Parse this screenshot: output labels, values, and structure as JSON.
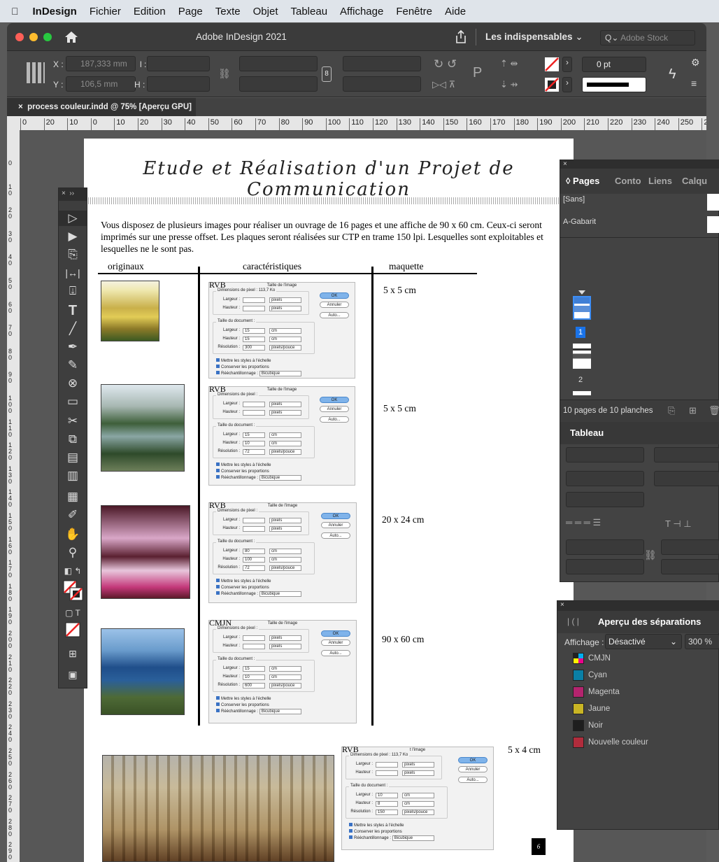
{
  "menubar": {
    "apple": "",
    "app": "InDesign",
    "items": [
      "Fichier",
      "Edition",
      "Page",
      "Texte",
      "Objet",
      "Tableau",
      "Affichage",
      "Fenêtre",
      "Aide"
    ]
  },
  "window": {
    "title": "Adobe InDesign 2021",
    "workspace": "Les indispensables",
    "stock_placeholder": "Adobe Stock"
  },
  "control": {
    "x_label": "X :",
    "x_value": "187,333 mm",
    "y_label": "Y :",
    "y_value": "106,5 mm",
    "w_label": "l :",
    "h_label": "H :",
    "stroke_pt": "0 pt"
  },
  "doc_tab": {
    "close": "×",
    "label": "process couleur.indd @ 75% [Aperçu GPU]"
  },
  "rulers": {
    "h": [
      "0",
      "20",
      "10",
      "0",
      "10",
      "20",
      "30",
      "40",
      "50",
      "60",
      "70",
      "80",
      "90",
      "100",
      "110",
      "120",
      "130",
      "140",
      "150",
      "160",
      "170",
      "180",
      "190",
      "200",
      "210",
      "220",
      "230",
      "240",
      "250",
      "2"
    ],
    "v": [
      "0",
      "10",
      "20",
      "30",
      "40",
      "50",
      "60",
      "70",
      "80",
      "90",
      "100",
      "110",
      "120",
      "130",
      "140",
      "150",
      "160",
      "170",
      "180",
      "190",
      "200",
      "210",
      "220",
      "230",
      "240",
      "250",
      "260",
      "270",
      "280",
      "290"
    ]
  },
  "page": {
    "title": "Etude et Réalisation d'un Projet de Communication",
    "intro": "Vous disposez de plusieurs images pour réaliser un ouvrage de 16 pages et une affiche de 90 x 60 cm. Ceux-ci seront imprimés sur une presse offset. Les plaques seront réalisées sur CTP en trame 150 lpi. Lesquelles sont exploitables et lesquelles ne le sont pas.",
    "col_originaux": "originaux",
    "col_caract": "caractéristiques",
    "col_maquette": "maquette",
    "dialog": {
      "title": "Taille de l'image",
      "ok": "OK",
      "annuler": "Annuler",
      "auto": "Auto...",
      "dim_pixel": "Dimensions de pixel",
      "taille_doc": "Taille du document :",
      "largeur": "Largeur :",
      "hauteur": "Hauteur :",
      "resolution": "Résolution :",
      "pixels": "pixels",
      "cm": "cm",
      "pixpouce": "pixels/pouce",
      "ck1": "Mettre les styles à l'échelle",
      "ck2": "Conserver les proportions",
      "ck3": "Rééchantillonnage :",
      "bicubique": "Bicubique"
    },
    "rows": [
      {
        "mode": "RVB",
        "pix": "Dimensions de pixel : 113,7 Ko",
        "l": "15",
        "h": "15",
        "res": "300",
        "size": "5 x 5 cm"
      },
      {
        "mode": "RVB",
        "pix": "Dimensions de pixel :",
        "l": "15",
        "h": "10",
        "res": "72",
        "size": "5 x 5 cm"
      },
      {
        "mode": "RVB",
        "pix": "Dimensions de pixel :",
        "l": "80",
        "h": "100",
        "res": "72",
        "size": "20 x 24 cm"
      },
      {
        "mode": "CMJN",
        "pix": "Dimensions de pixel :",
        "l": "15",
        "h": "10",
        "res": "600",
        "size": "90 x 60 cm"
      },
      {
        "mode": "RVB",
        "pix": "Dimensions de pixel : 113,7 Ko",
        "l": "10",
        "h": "8",
        "res": "150",
        "size": "5 x 4 cm",
        "title": "t l'image"
      }
    ],
    "page_number": "6"
  },
  "pages_panel": {
    "tabs": [
      "Pages",
      "Conto",
      "Liens",
      "Calqu"
    ],
    "none": "[Sans]",
    "master": "A-Gabarit",
    "page1": "1",
    "page2": "2",
    "footer": "10 pages de 10 planches",
    "table_title": "Tableau"
  },
  "sep_panel": {
    "title": "Aperçu des séparations",
    "affichage_label": "Affichage :",
    "affichage_value": "Désactivé",
    "zoom": "300 %",
    "inks": [
      {
        "name": "CMJN",
        "color": "#000000"
      },
      {
        "name": "Cyan",
        "color": "#0a7fa6"
      },
      {
        "name": "Magenta",
        "color": "#b4246e"
      },
      {
        "name": "Jaune",
        "color": "#c9b524"
      },
      {
        "name": "Noir",
        "color": "#1e1e1e"
      },
      {
        "name": "Nouvelle couleur",
        "color": "#b12c3c"
      }
    ]
  }
}
